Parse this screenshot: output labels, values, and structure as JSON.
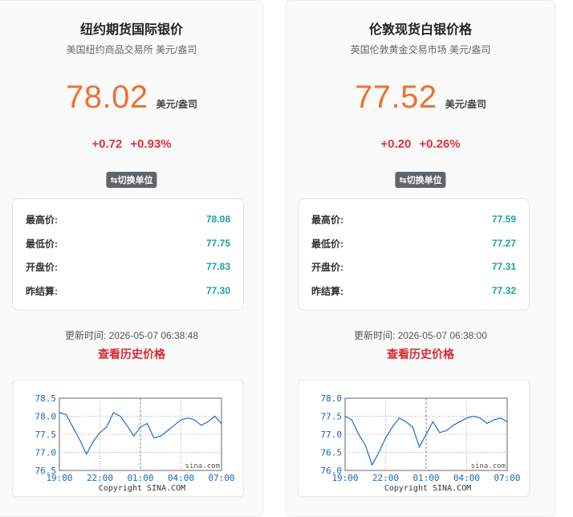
{
  "cards": [
    {
      "title": "纽约期货国际银价",
      "subtitle": "美国纽约商品交易所 美元/盎司",
      "price": "78.02",
      "price_unit": "美元/盎司",
      "change": "+0.72",
      "change_pct": "+0.93%",
      "switch_label": "⇆切换单位",
      "stats": [
        {
          "label": "最高价:",
          "value": "78.08"
        },
        {
          "label": "最低价:",
          "value": "77.75"
        },
        {
          "label": "开盘价:",
          "value": "77.83"
        },
        {
          "label": "昨结算:",
          "value": "77.30"
        }
      ],
      "update_time": "更新时间: 2026-05-07 06:38:48",
      "history_link": "查看历史价格",
      "chart": {
        "y_ticks": [
          "78.5",
          "78.0",
          "77.5",
          "77.0",
          "76.5"
        ],
        "x_ticks": [
          "19:00",
          "22:00",
          "01:00",
          "04:00",
          "07:00"
        ],
        "watermark": "sina.com",
        "copyright": "Copyright  SINA.COM"
      }
    },
    {
      "title": "伦敦现货白银价格",
      "subtitle": "英国伦敦黄金交易市场 美元/盎司",
      "price": "77.52",
      "price_unit": "美元/盎司",
      "change": "+0.20",
      "change_pct": "+0.26%",
      "switch_label": "⇆切换单位",
      "stats": [
        {
          "label": "最高价:",
          "value": "77.59"
        },
        {
          "label": "最低价:",
          "value": "77.27"
        },
        {
          "label": "开盘价:",
          "value": "77.31"
        },
        {
          "label": "昨结算:",
          "value": "77.32"
        }
      ],
      "update_time": "更新时间: 2026-05-07 06:38:00",
      "history_link": "查看历史价格",
      "chart": {
        "y_ticks": [
          "78.0",
          "77.5",
          "77.0",
          "76.5",
          "76.0"
        ],
        "x_ticks": [
          "19:00",
          "22:00",
          "01:00",
          "04:00",
          "07:00"
        ],
        "watermark": "sina.com",
        "copyright": "Copyright  SINA.COM"
      }
    }
  ],
  "chart_data": [
    {
      "type": "line",
      "ylim": [
        76.5,
        78.5
      ],
      "x": [
        "19:00",
        "19:30",
        "20:00",
        "20:30",
        "21:00",
        "21:30",
        "22:00",
        "22:30",
        "23:00",
        "23:30",
        "00:00",
        "00:30",
        "01:00",
        "01:30",
        "02:00",
        "02:30",
        "03:00",
        "03:30",
        "04:00",
        "04:30",
        "05:00",
        "05:30",
        "06:00",
        "06:30",
        "07:00"
      ],
      "values": [
        78.1,
        78.05,
        77.7,
        77.35,
        76.95,
        77.3,
        77.55,
        77.7,
        78.1,
        78.0,
        77.75,
        77.45,
        77.7,
        77.8,
        77.4,
        77.45,
        77.6,
        77.75,
        77.9,
        77.95,
        77.9,
        77.75,
        77.85,
        78.0,
        77.8
      ],
      "line_color": "#1f6fc0"
    },
    {
      "type": "line",
      "ylim": [
        76.0,
        78.0
      ],
      "x": [
        "19:00",
        "19:30",
        "20:00",
        "20:30",
        "21:00",
        "21:30",
        "22:00",
        "22:30",
        "23:00",
        "23:30",
        "00:00",
        "00:30",
        "01:00",
        "01:30",
        "02:00",
        "02:30",
        "03:00",
        "03:30",
        "04:00",
        "04:30",
        "05:00",
        "05:30",
        "06:00",
        "06:30",
        "07:00"
      ],
      "values": [
        77.5,
        77.4,
        77.0,
        76.7,
        76.15,
        76.5,
        76.9,
        77.2,
        77.45,
        77.35,
        77.2,
        76.65,
        77.0,
        77.35,
        77.05,
        77.1,
        77.25,
        77.35,
        77.45,
        77.5,
        77.45,
        77.3,
        77.4,
        77.45,
        77.35
      ],
      "line_color": "#1f6fc0"
    }
  ]
}
